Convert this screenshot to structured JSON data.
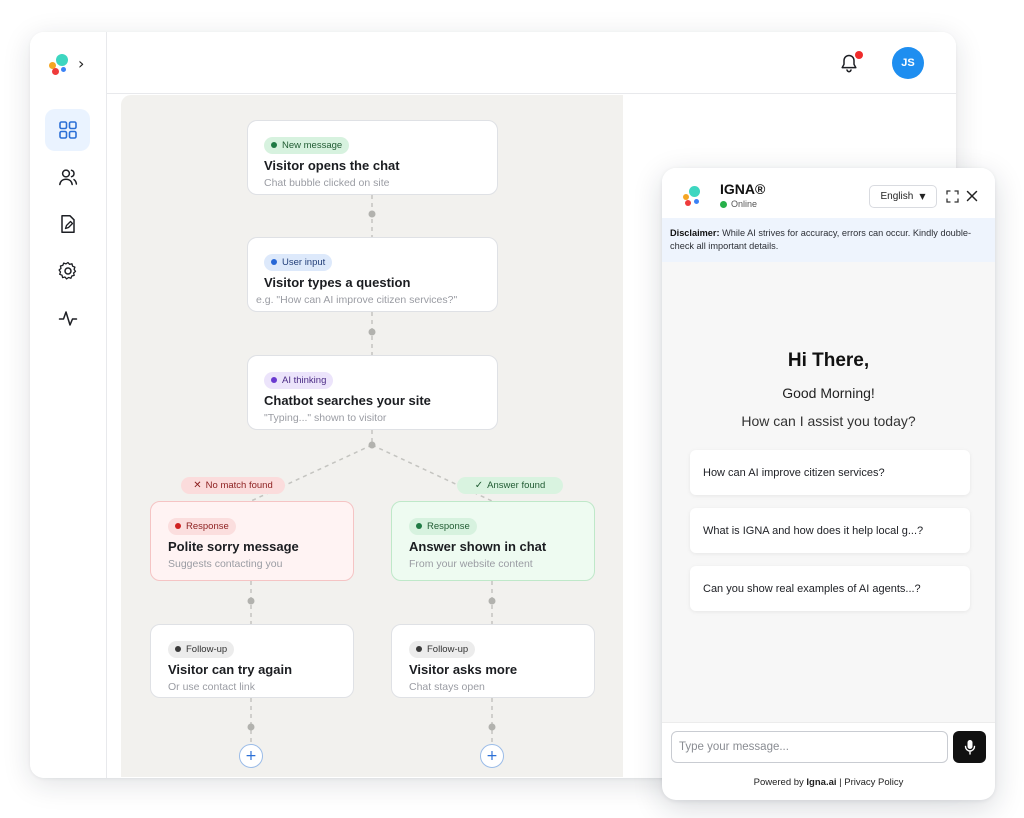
{
  "header": {
    "avatar_initials": "JS",
    "notification_dot_color": "#ef2b2b"
  },
  "sidebar": {
    "items": [
      {
        "icon": "dashboard-icon",
        "active": true
      },
      {
        "icon": "users-icon",
        "active": false
      },
      {
        "icon": "document-edit-icon",
        "active": false
      },
      {
        "icon": "settings-icon",
        "active": false
      },
      {
        "icon": "activity-icon",
        "active": false
      }
    ]
  },
  "flow": {
    "nodes": [
      {
        "tag": "New message",
        "title": "Visitor opens the chat",
        "sub": "Chat bubble clicked on site"
      },
      {
        "tag": "User input",
        "title": "Visitor types a question",
        "sub": "e.g. \"How can AI improve citizen services?\""
      },
      {
        "tag": "AI thinking",
        "title": "Chatbot searches your site",
        "sub": "\"Typing...\" shown to visitor"
      }
    ],
    "branches": {
      "no_match": "No match found",
      "answer": "Answer found"
    },
    "left": [
      {
        "tag": "Response",
        "title": "Polite sorry message",
        "sub": "Suggests contacting you"
      },
      {
        "tag": "Follow-up",
        "title": "Visitor can try again",
        "sub": "Or use contact link"
      }
    ],
    "right": [
      {
        "tag": "Response",
        "title": "Answer shown in chat",
        "sub": "From your website content"
      },
      {
        "tag": "Follow-up",
        "title": "Visitor asks more",
        "sub": "Chat stays open"
      }
    ],
    "add_label": "+"
  },
  "chat": {
    "name": "IGNA®",
    "status": "Online",
    "language": "English",
    "disclaimer_label": "Disclaimer:",
    "disclaimer_text": " While AI strives for accuracy, errors can occur. Kindly double-check all important details.",
    "greeting": "Hi There,",
    "sub_greeting": "Good Morning!",
    "prompt": "How can I assist you today?",
    "suggestions": [
      "How can AI improve citizen services?",
      "What is IGNA and how does it help local g...?",
      "Can you show real examples of AI agents...?"
    ],
    "input_placeholder": "Type your message...",
    "powered_prefix": "Powered by ",
    "powered_brand": "Igna.ai",
    "privacy": " | Privacy Policy"
  },
  "colors": {
    "accent_blue": "#1e8ef0",
    "online_green": "#27b04a",
    "logo_teal": "#3dd6c0",
    "logo_orange": "#f5a623",
    "logo_red": "#ef3b3b",
    "logo_blue": "#3b82f6"
  }
}
